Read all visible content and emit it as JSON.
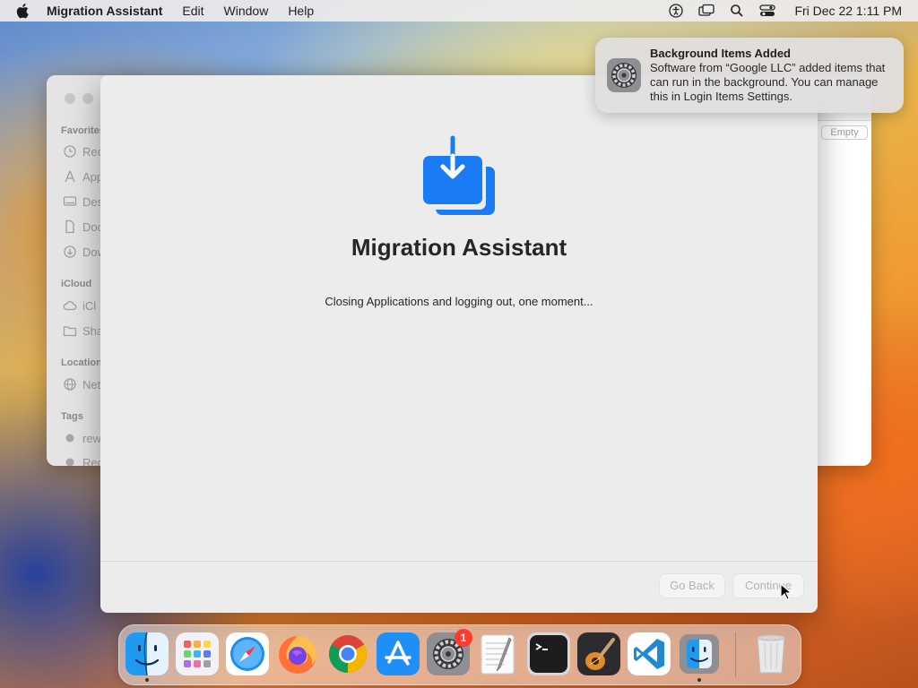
{
  "menubar": {
    "app_name": "Migration Assistant",
    "items": [
      "Edit",
      "Window",
      "Help"
    ],
    "clock": "Fri Dec 22  1:11 PM"
  },
  "finder": {
    "sections": [
      "Favorites",
      "iCloud",
      "Locations",
      "Tags"
    ],
    "rows": [
      "Rec",
      "App",
      "Des",
      "Doc",
      "Dow",
      "iCl",
      "Sha",
      "Net",
      "rew",
      "Red"
    ],
    "empty_label": "Empty"
  },
  "migration": {
    "title": "Migration Assistant",
    "status": "Closing Applications and logging out, one moment...",
    "go_back_label": "Go Back",
    "continue_label": "Continue"
  },
  "notification": {
    "title": "Background Items Added",
    "body": "Software from “Google LLC” added items that can run in the background. You can manage this in Login Items Settings."
  },
  "dock": {
    "apps": [
      "finder",
      "launchpad",
      "safari",
      "firefox",
      "chrome",
      "app-store",
      "system-settings",
      "textedit",
      "terminal",
      "garageband",
      "vscode",
      "migration-assistant",
      "trash"
    ],
    "settings_badge": "1"
  },
  "colors": {
    "accent_blue": "#1a7cf5",
    "badge_red": "#ff3b30"
  }
}
